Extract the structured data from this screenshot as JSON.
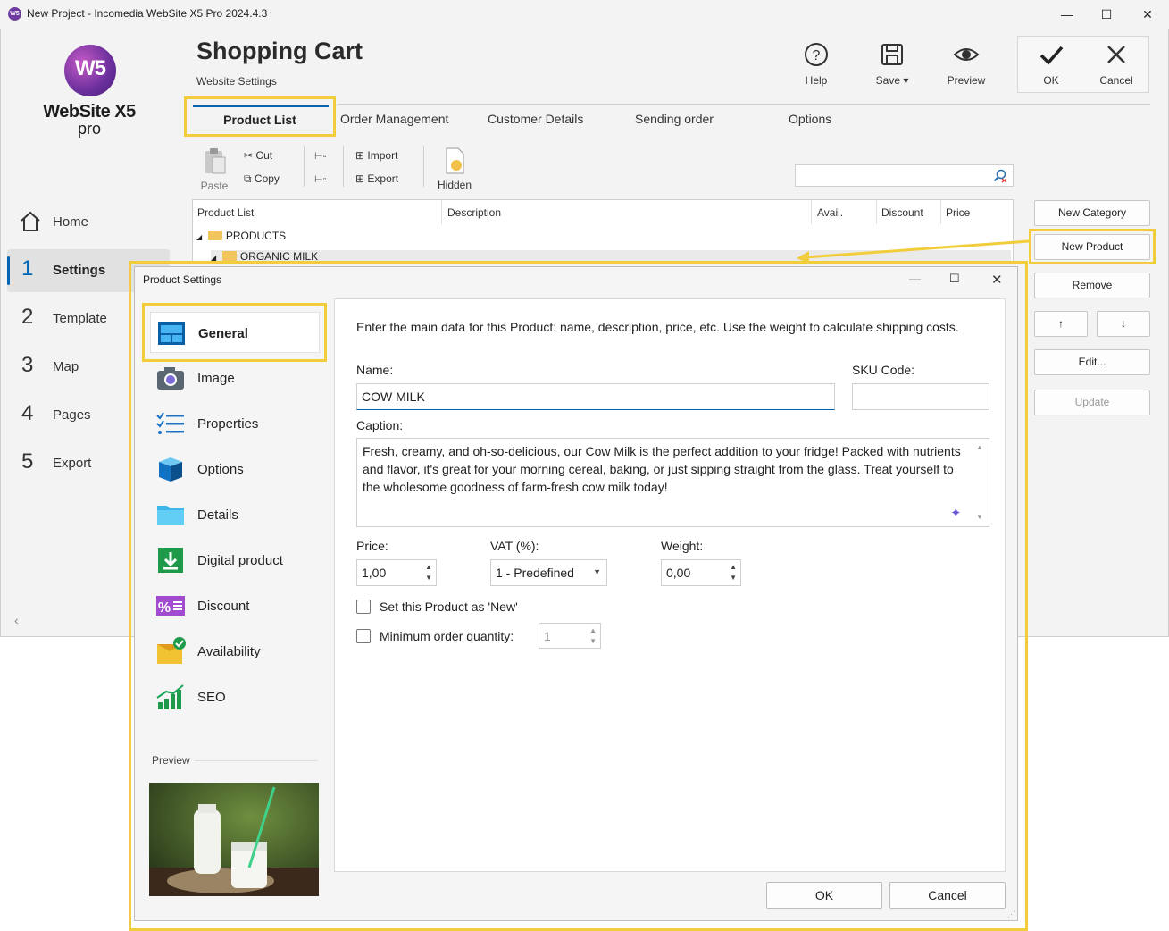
{
  "window": {
    "title": "New Project - Incomedia WebSite X5 Pro 2024.4.3",
    "app_icon": "W5"
  },
  "logo": {
    "mark": "W5",
    "brand": "WebSite X5",
    "edition": "pro"
  },
  "header": {
    "title": "Shopping Cart",
    "subtitle": "Website Settings",
    "help_label": "Help",
    "save_label": "Save",
    "preview_label": "Preview",
    "ok_label": "OK",
    "cancel_label": "Cancel"
  },
  "tabs": [
    "Product List",
    "Order Management",
    "Customer Details",
    "Sending order",
    "Options"
  ],
  "ribbon": {
    "paste": "Paste",
    "cut": "Cut",
    "copy": "Copy",
    "import": "Import",
    "export": "Export",
    "hidden": "Hidden",
    "search_placeholder": ""
  },
  "nav": [
    {
      "num": "",
      "label": "Home"
    },
    {
      "num": "1",
      "label": "Settings"
    },
    {
      "num": "2",
      "label": "Template"
    },
    {
      "num": "3",
      "label": "Map"
    },
    {
      "num": "4",
      "label": "Pages"
    },
    {
      "num": "5",
      "label": "Export"
    }
  ],
  "table": {
    "columns": [
      "Product List",
      "Description",
      "Avail.",
      "Discount",
      "Price"
    ],
    "rows": [
      "PRODUCTS",
      "ORGANIC MILK"
    ]
  },
  "side_buttons": {
    "new_category": "New Category",
    "new_product": "New Product",
    "remove": "Remove",
    "up": "↑",
    "down": "↓",
    "edit": "Edit...",
    "update": "Update"
  },
  "dialog": {
    "title": "Product Settings",
    "sections": [
      {
        "label": "General",
        "icon": "general-icon"
      },
      {
        "label": "Image",
        "icon": "camera-icon"
      },
      {
        "label": "Properties",
        "icon": "list-icon"
      },
      {
        "label": "Options",
        "icon": "cube-icon"
      },
      {
        "label": "Details",
        "icon": "folder-icon"
      },
      {
        "label": "Digital product",
        "icon": "download-icon"
      },
      {
        "label": "Discount",
        "icon": "percent-icon"
      },
      {
        "label": "Availability",
        "icon": "availability-icon"
      },
      {
        "label": "SEO",
        "icon": "chart-icon"
      }
    ],
    "preview_label": "Preview",
    "intro": "Enter the main data for this Product: name, description, price, etc. Use the weight to calculate shipping costs.",
    "name_label": "Name:",
    "name_value": "COW MILK",
    "sku_label": "SKU Code:",
    "sku_value": "",
    "caption_label": "Caption:",
    "caption_value": "Fresh, creamy, and oh-so-delicious, our Cow Milk is the perfect addition to your fridge! Packed with nutrients and flavor, it's great for your morning cereal, baking, or just sipping straight from the glass. Treat yourself to the wholesome goodness of farm-fresh cow milk today!",
    "price_label": "Price:",
    "price_value": "1,00",
    "vat_label": "VAT (%):",
    "vat_value": "1 - Predefined",
    "weight_label": "Weight:",
    "weight_value": "0,00",
    "new_checkbox_label": "Set this Product as 'New'",
    "min_qty_label": "Minimum order quantity:",
    "min_qty_value": "1",
    "ok_label": "OK",
    "cancel_label": "Cancel"
  },
  "colors": {
    "accent": "#0066b3",
    "highlight": "#f2cd3b",
    "brand": "#6a2f9c"
  }
}
